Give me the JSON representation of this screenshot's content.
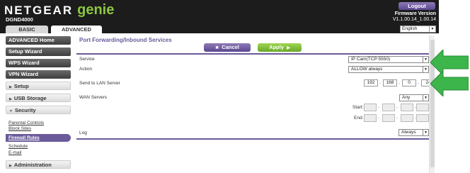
{
  "header": {
    "brand": "NETGEAR",
    "product": "genie",
    "model": "DGND4000",
    "logout_label": "Logout",
    "firmware_label": "Firmware Version",
    "firmware_value": "V1.1.00.14_1.00.14"
  },
  "tabs": [
    {
      "label": "BASIC",
      "active": false
    },
    {
      "label": "ADVANCED",
      "active": true
    }
  ],
  "language": {
    "selected": "English"
  },
  "sidebar": {
    "items": [
      {
        "label": "ADVANCED Home"
      },
      {
        "label": "Setup Wizard"
      },
      {
        "label": "WPS Wizard"
      },
      {
        "label": "VPN Wizard"
      },
      {
        "label": "Setup"
      },
      {
        "label": "USB Storage"
      },
      {
        "label": "Security"
      },
      {
        "label": "Administration"
      }
    ],
    "security_sub": [
      {
        "label": "Parental Controls"
      },
      {
        "label": "Block Sites"
      },
      {
        "label": "Firewall Rules",
        "active": true
      },
      {
        "label": "Schedule"
      },
      {
        "label": "E-mail"
      }
    ]
  },
  "main": {
    "title": "Port Forwarding/Inbound Services",
    "cancel_label": "Cancel",
    "apply_label": "Apply",
    "service_label": "Service",
    "service_value": "IP Cam(TCP:5550)",
    "action_label": "Action",
    "action_value": "ALLOW always",
    "lan_label": "Send to LAN Server",
    "lan_ip": [
      "192",
      "168",
      "0",
      "24"
    ],
    "wan_label": "WAN Servers",
    "wan_value": "Any",
    "start_label": "Start:",
    "end_label": "End:",
    "log_label": "Log",
    "log_value": "Always"
  },
  "colors": {
    "header_bg": "#1c1c1c",
    "accent_purple": "#6b5b9a",
    "genie_green": "#8cc63f",
    "annotation_arrow": "#3cb54a"
  },
  "icons": {
    "cancel": "close-icon",
    "apply": "arrow-right-icon",
    "dropdown": "chevron-down-icon",
    "sidebar_expand": "triangle-right-icon"
  }
}
